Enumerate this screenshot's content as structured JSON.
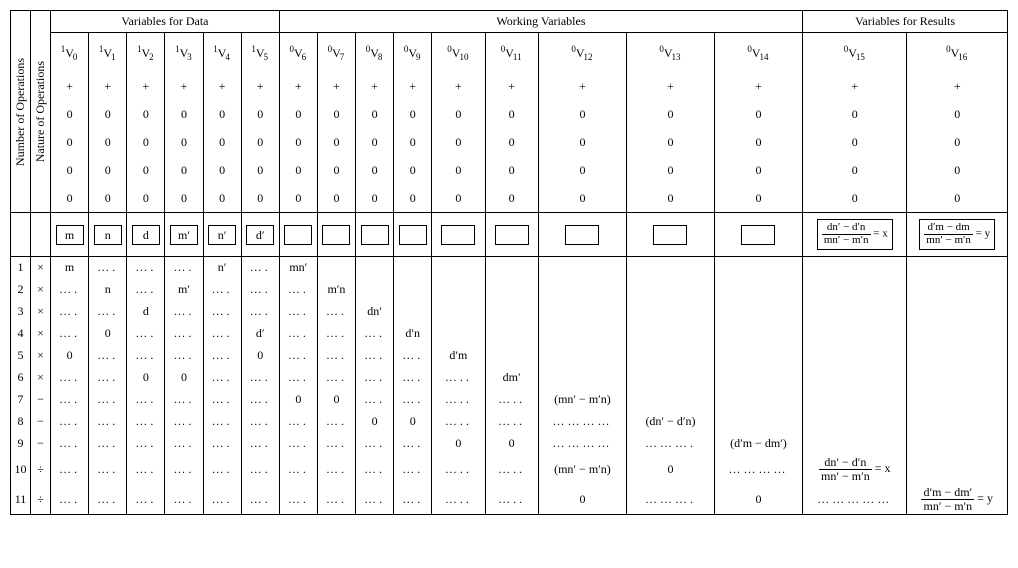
{
  "headers": {
    "num_ops": "Number of Operations",
    "nat_ops": "Nature of Operations",
    "data": "Variables for Data",
    "working": "Working Variables",
    "results": "Variables for Results"
  },
  "sup_row": {
    "plus": "+",
    "zero": "0"
  },
  "vars": {
    "v0": {
      "sup": "1",
      "name": "V",
      "sub": "0"
    },
    "v1": {
      "sup": "1",
      "name": "V",
      "sub": "1"
    },
    "v2": {
      "sup": "1",
      "name": "V",
      "sub": "2"
    },
    "v3": {
      "sup": "1",
      "name": "V",
      "sub": "3"
    },
    "v4": {
      "sup": "1",
      "name": "V",
      "sub": "4"
    },
    "v5": {
      "sup": "1",
      "name": "V",
      "sub": "5"
    },
    "v6": {
      "sup": "0",
      "name": "V",
      "sub": "6"
    },
    "v7": {
      "sup": "0",
      "name": "V",
      "sub": "7"
    },
    "v8": {
      "sup": "0",
      "name": "V",
      "sub": "8"
    },
    "v9": {
      "sup": "0",
      "name": "V",
      "sub": "9"
    },
    "v10": {
      "sup": "0",
      "name": "V",
      "sub": "10"
    },
    "v11": {
      "sup": "0",
      "name": "V",
      "sub": "11"
    },
    "v12": {
      "sup": "0",
      "name": "V",
      "sub": "12"
    },
    "v13": {
      "sup": "0",
      "name": "V",
      "sub": "13"
    },
    "v14": {
      "sup": "0",
      "name": "V",
      "sub": "14"
    },
    "v15": {
      "sup": "0",
      "name": "V",
      "sub": "15"
    },
    "v16": {
      "sup": "0",
      "name": "V",
      "sub": "16"
    }
  },
  "boxrow": {
    "b0": "m",
    "b1": "n",
    "b2": "d",
    "b3": "m′",
    "b4": "n′",
    "b5": "d′"
  },
  "result_boxes": {
    "x": {
      "num": "dn′ − d′n",
      "den": "mn′ − m′n",
      "rhs": " = x"
    },
    "y": {
      "num": "d′m − dm",
      "den": "mn′ − m′n",
      "rhs": " = y"
    }
  },
  "steps": {
    "s1": {
      "n": "1",
      "op": "×",
      "v0": "m",
      "v1": "….",
      "v2": "….",
      "v3": "….",
      "v4": "n′",
      "v5": "….",
      "v6": "mn′"
    },
    "s2": {
      "n": "2",
      "op": "×",
      "v0": "….",
      "v1": "n",
      "v2": "….",
      "v3": "m′",
      "v4": "….",
      "v5": "….",
      "v6": "….",
      "v7": "m′n"
    },
    "s3": {
      "n": "3",
      "op": "×",
      "v0": "….",
      "v1": "….",
      "v2": "d",
      "v3": "….",
      "v4": "….",
      "v5": "….",
      "v6": "….",
      "v7": "….",
      "v8": "dn′"
    },
    "s4": {
      "n": "4",
      "op": "×",
      "v0": "….",
      "v1": "0",
      "v2": "….",
      "v3": "….",
      "v4": "….",
      "v5": "d′",
      "v6": "….",
      "v7": "….",
      "v8": "….",
      "v9": "d′n"
    },
    "s5": {
      "n": "5",
      "op": "×",
      "v0": "0",
      "v1": "….",
      "v2": "….",
      "v3": "….",
      "v4": "….",
      "v5": "0",
      "v6": "….",
      "v7": "….",
      "v8": "….",
      "v9": "….",
      "v10": "d′m"
    },
    "s6": {
      "n": "6",
      "op": "×",
      "v0": "….",
      "v1": "….",
      "v2": "0",
      "v3": "0",
      "v4": "….",
      "v5": "….",
      "v6": "….",
      "v7": "….",
      "v8": "….",
      "v9": "….",
      "v10": "…..",
      "v11": "dm′"
    },
    "s7": {
      "n": "7",
      "op": "−",
      "v0": "….",
      "v1": "….",
      "v2": "….",
      "v3": "….",
      "v4": "….",
      "v5": "….",
      "v6": "0",
      "v7": "0",
      "v8": "….",
      "v9": "….",
      "v10": "…..",
      "v11": "…..",
      "v12": "(mn′ − m′n)"
    },
    "s8": {
      "n": "8",
      "op": "−",
      "v0": "….",
      "v1": "….",
      "v2": "….",
      "v3": "….",
      "v4": "….",
      "v5": "….",
      "v6": "….",
      "v7": "….",
      "v8": "0",
      "v9": "0",
      "v10": "…..",
      "v11": "…..",
      "v12": "…………",
      "v13": "(dn′ − d′n)"
    },
    "s9": {
      "n": "9",
      "op": "−",
      "v0": "….",
      "v1": "….",
      "v2": "….",
      "v3": "….",
      "v4": "….",
      "v5": "….",
      "v6": "….",
      "v7": "….",
      "v8": "….",
      "v9": "….",
      "v10": "0",
      "v11": "0",
      "v12": "…………",
      "v13": "……….",
      "v14": "(d′m − dm′)"
    },
    "s10": {
      "n": "10",
      "op": "÷",
      "v0": "….",
      "v1": "….",
      "v2": "….",
      "v3": "….",
      "v4": "….",
      "v5": "….",
      "v6": "….",
      "v7": "….",
      "v8": "….",
      "v9": "….",
      "v10": "…..",
      "v11": "…..",
      "v12": "(mn′ − m′n)",
      "v13": "0",
      "v14": "…………",
      "r15": {
        "num": "dn′ − d′n",
        "den": "mn′ − m′n",
        "rhs": " = x"
      }
    },
    "s11": {
      "n": "11",
      "op": "÷",
      "v0": "….",
      "v1": "….",
      "v2": "….",
      "v3": "….",
      "v4": "….",
      "v5": "….",
      "v6": "….",
      "v7": "….",
      "v8": "….",
      "v9": "….",
      "v10": "…..",
      "v11": "…..",
      "v12": "0",
      "v13": "……….",
      "v14": "0",
      "r15": "……………",
      "r16": {
        "num": "d′m − dm′",
        "den": "mn′ − m′n",
        "rhs": " = y"
      }
    }
  }
}
